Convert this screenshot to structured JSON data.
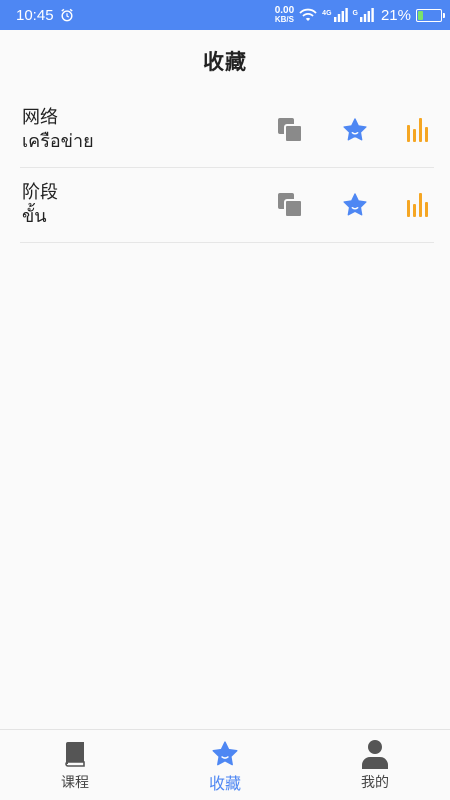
{
  "status_bar": {
    "time": "10:45",
    "speed_value": "0.00",
    "speed_unit": "KB/S",
    "network_1": "4G",
    "network_2": "G",
    "battery_percent": "21%",
    "battery_level": 0.21
  },
  "header": {
    "title": "收藏"
  },
  "favorites": [
    {
      "chinese": "网络",
      "thai": "เครือข่าย"
    },
    {
      "chinese": "阶段",
      "thai": "ขั้น"
    }
  ],
  "bottom_nav": {
    "items": [
      {
        "label": "课程",
        "icon": "book-icon",
        "active": false
      },
      {
        "label": "收藏",
        "icon": "star-icon",
        "active": true
      },
      {
        "label": "我的",
        "icon": "person-icon",
        "active": false
      }
    ]
  },
  "colors": {
    "accent": "#4e87f3",
    "copy_icon": "#8a8a8a",
    "audio_icon": "#f5a623",
    "nav_icon": "#555555"
  }
}
